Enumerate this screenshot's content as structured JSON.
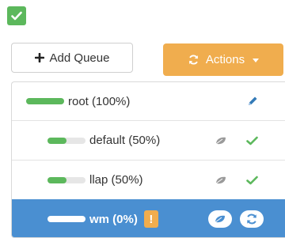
{
  "toolbar": {
    "add_queue_label": "Add Queue",
    "actions_label": "Actions"
  },
  "queues": [
    {
      "label": "root (100%)",
      "capacity_percent": 100,
      "level": 0
    },
    {
      "label": "default (50%)",
      "capacity_percent": 50,
      "level": 1,
      "state": "running"
    },
    {
      "label": "llap (50%)",
      "capacity_percent": 50,
      "level": 1,
      "state": "running"
    },
    {
      "label": "wm (0%)",
      "capacity_percent": 0,
      "level": 1,
      "selected": true,
      "warning": "!"
    }
  ],
  "icons": {
    "top_check": "check-icon",
    "add": "plus-icon",
    "actions": "refresh-icon",
    "edit": "pencil-icon",
    "leaf": "leaf-icon",
    "running": "check-icon",
    "refresh": "refresh-icon"
  },
  "colors": {
    "success_green": "#5cb85c",
    "warning_orange": "#f0ad4e",
    "selected_blue": "#4a8fd1",
    "edit_blue": "#337ab7"
  }
}
